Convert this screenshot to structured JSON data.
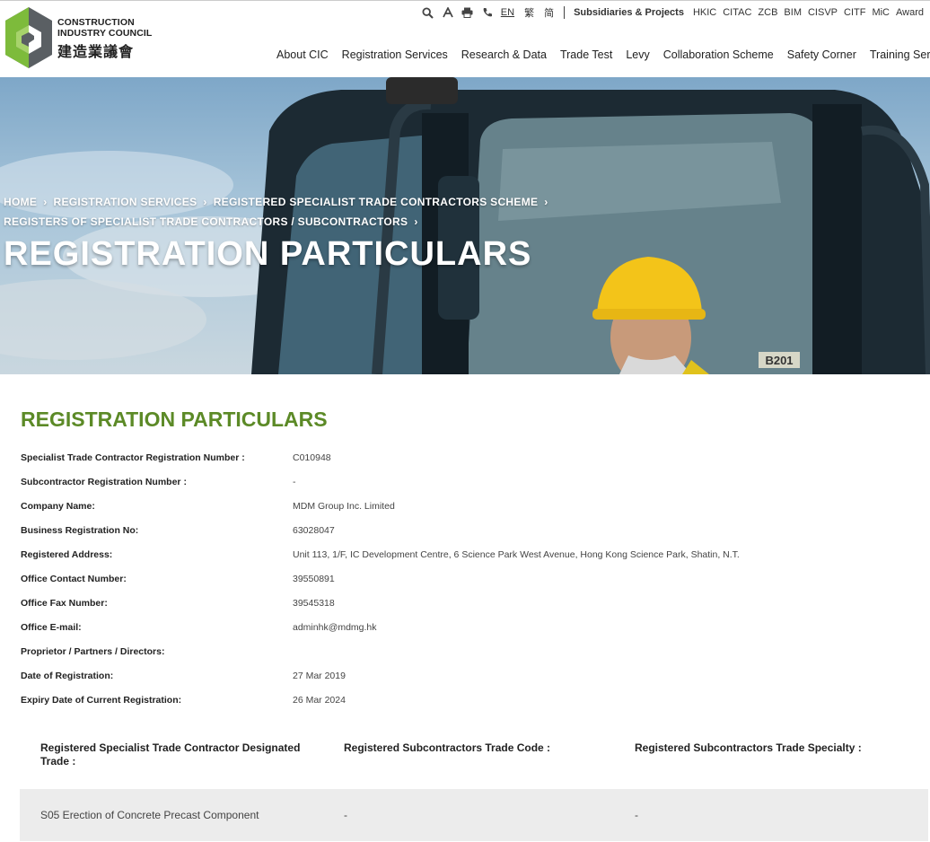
{
  "header": {
    "logo_en": "CONSTRUCTION\nINDUSTRY COUNCIL",
    "logo_zh": "建造業議會",
    "utility": {
      "icons": [
        "search-icon",
        "font-size-icon",
        "print-icon",
        "phone-icon"
      ],
      "languages": [
        "EN",
        "繁",
        "简"
      ],
      "active_language": "EN",
      "subsidiaries_label": "Subsidiaries & Projects",
      "subsidiaries": [
        "HKIC",
        "CITAC",
        "ZCB",
        "BIM",
        "CISVP",
        "CITF",
        "MiC",
        "Award"
      ]
    },
    "nav": [
      "About CIC",
      "Registration Services",
      "Research & Data",
      "Trade Test",
      "Levy",
      "Collaboration Scheme",
      "Safety Corner",
      "Training Servic"
    ]
  },
  "hero": {
    "breadcrumb": [
      "HOME",
      "REGISTRATION SERVICES",
      "REGISTERED SPECIALIST TRADE CONTRACTORS SCHEME",
      "REGISTERS OF SPECIALIST TRADE CONTRACTORS / SUBCONTRACTORS"
    ],
    "title": "REGISTRATION PARTICULARS",
    "plate_text": "B201"
  },
  "main": {
    "title": "REGISTRATION PARTICULARS",
    "details": [
      {
        "label": "Specialist Trade Contractor Registration Number :",
        "value": "C010948"
      },
      {
        "label": "Subcontractor Registration Number :",
        "value": "-"
      },
      {
        "label": "Company Name:",
        "value": "MDM Group Inc. Limited"
      },
      {
        "label": "Business Registration No:",
        "value": "63028047"
      },
      {
        "label": "Registered Address:",
        "value": "Unit 113, 1/F, IC Development Centre, 6 Science Park West Avenue, Hong Kong Science Park, Shatin, N.T."
      },
      {
        "label": "Office Contact Number:",
        "value": "39550891"
      },
      {
        "label": "Office Fax Number:",
        "value": "39545318"
      },
      {
        "label": "Office E-mail:",
        "value": "adminhk@mdmg.hk"
      },
      {
        "label": "Proprietor / Partners / Directors:",
        "value": ""
      },
      {
        "label": "Date of Registration:",
        "value": "27 Mar 2019"
      },
      {
        "label": "Expiry Date of Current Registration:",
        "value": "26 Mar 2024"
      }
    ],
    "trade_table": {
      "headers": [
        "Registered Specialist Trade Contractor Designated Trade :",
        "Registered Subcontractors Trade Code :",
        "Registered Subcontractors Trade Specialty :"
      ],
      "rows": [
        [
          "S05 Erection of Concrete Precast Component",
          "-",
          "-"
        ]
      ]
    }
  },
  "colors": {
    "accent_green": "#5c8a27",
    "row_bg": "#ececec"
  }
}
